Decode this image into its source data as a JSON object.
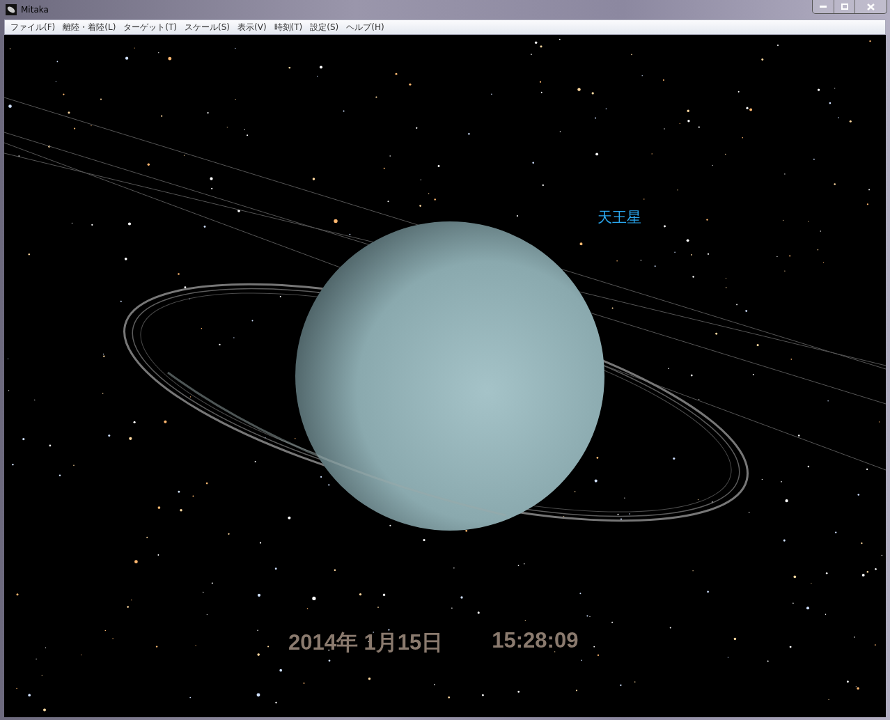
{
  "window": {
    "title": "Mitaka"
  },
  "menu": [
    {
      "label": "ファイル(F)"
    },
    {
      "label": "離陸・着陸(L)"
    },
    {
      "label": "ターゲット(T)"
    },
    {
      "label": "スケール(S)"
    },
    {
      "label": "表示(V)"
    },
    {
      "label": "時刻(T)"
    },
    {
      "label": "設定(S)"
    },
    {
      "label": "ヘルプ(H)"
    }
  ],
  "view": {
    "planet_label": "天王星",
    "date": "2014年 1月15日",
    "time": "15:28:09"
  }
}
